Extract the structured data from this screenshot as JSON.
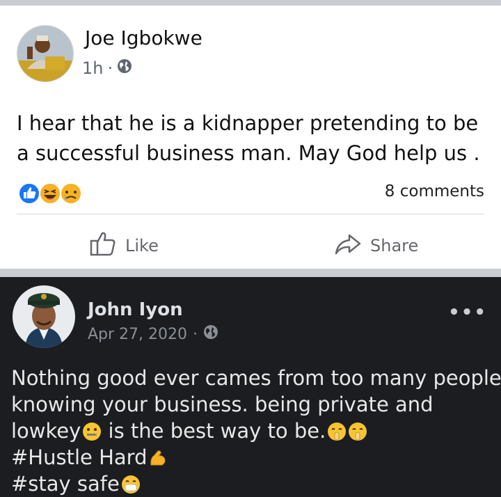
{
  "post1": {
    "author": "Joe Igbokwe",
    "time": "1h",
    "separator": "·",
    "privacy_icon": "globe-icon",
    "text": "I hear that he is a kidnapper pretending to be a successful business man. May God help us .",
    "reactions": [
      "like",
      "haha",
      "sad"
    ],
    "comments": "8 comments",
    "actions": {
      "like": "Like",
      "share": "Share"
    }
  },
  "post2": {
    "author": "John Iyon",
    "time": "Apr 27, 2020",
    "separator": "·",
    "privacy_icon": "globe-icon",
    "more_icon": "more-options-icon",
    "lines": [
      "Nothing good ever cames from too many people",
      "knowing your business. being private and",
      "lowkey",
      "is the best way to be.",
      "#Hustle Hard",
      "#stay safe"
    ]
  },
  "colors": {
    "like_blue": "#1877f2",
    "dark_bg": "#1b1d21",
    "meta_grey": "#606770"
  }
}
